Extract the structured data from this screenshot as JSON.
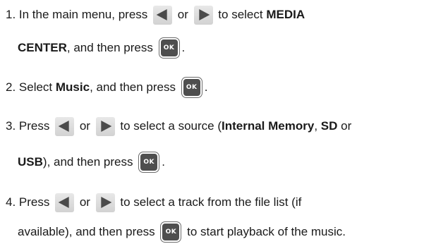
{
  "icons": {
    "left_arrow": "left-arrow-icon",
    "right_arrow": "right-arrow-icon",
    "ok": "ok-button-icon"
  },
  "ok_label": "OK",
  "steps": [
    {
      "number": "1.",
      "l1_a": " In the main menu, press ",
      "l1_or": " or ",
      "l1_b": " to select ",
      "l1_bold": "MEDIA",
      "l2_bold": "CENTER",
      "l2_a": ", and then press ",
      "l2_end": "."
    },
    {
      "number": "2.",
      "a": " Select ",
      "bold": "Music",
      "b": ", and then press ",
      "end": "."
    },
    {
      "number": "3.",
      "l1_a": " Press ",
      "l1_or": " or ",
      "l1_b": " to select a source (",
      "l1_bold1": "Internal Memory",
      "l1_c": ", ",
      "l1_bold2": "SD",
      "l1_d": " or",
      "l2_bold": "USB",
      "l2_a": "), and then press ",
      "l2_end": "."
    },
    {
      "number": "4.",
      "l1_a": " Press ",
      "l1_or": " or ",
      "l1_b": " to select a track from the file list (if",
      "l2_a": "available), and then press ",
      "l2_b": " to start playback of the music."
    }
  ]
}
